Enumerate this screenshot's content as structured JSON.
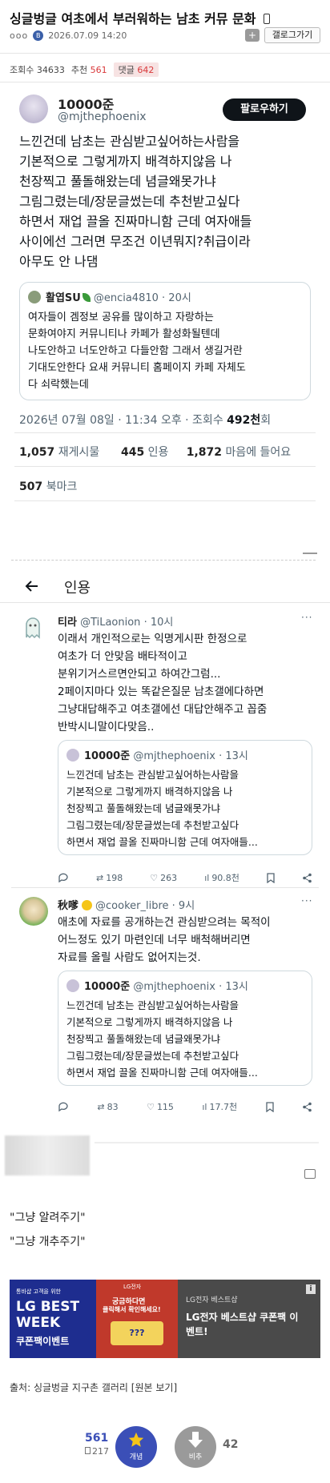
{
  "header": {
    "title": "싱글벙글 여초에서 부러워하는 남초 커뮤 문화",
    "title_icon": "phone-icon",
    "meta_dots": "ooo",
    "datetime": "2026.07.09 14:20",
    "back_label": "갤로그가기",
    "plus_label": "+"
  },
  "stats": {
    "views_label": "조회수",
    "views": "34633",
    "recommend_label": "추천",
    "recommend": "561",
    "comments_label": "댓글",
    "comments": "642"
  },
  "main_tweet": {
    "name": "10000준",
    "handle": "@mjthephoenix",
    "follow_label": "팔로우하기",
    "text_lines": [
      "느낀건데 남초는 관심받고싶어하는사람을",
      "기본적으로 그렇게까지 배격하지않음 나",
      "천장찍고 풀돌해왔는데 념글왜못가냐",
      "그림그렸는데/장문글썼는데 추천받고싶다",
      "하면서 재업 끌올 진짜마니함 근데 여자애들",
      "사이에선 그러면 무조건 이년뭐지?취급이라",
      "아무도 안 나댐"
    ],
    "quote": {
      "name": "활엽SU",
      "handle": "@encia4810",
      "time": "· 20시",
      "text_lines": [
        "여자들이 겜정보 공유를 많이하고 자랑하는",
        "문화여야지 커뮤니티나 카페가 활성화될텐데",
        "나도안하고 너도안하고 다들안함 그래서 생길거란",
        "기대도안한다 요새 커뮤니티 홈페이지 카페 자체도",
        "다 쇠락했는데"
      ]
    },
    "timestamp": "2026년 07월 08일 · 11:34 오후 · 조회수",
    "views": "492천",
    "views_suffix": "회",
    "retweets": "1,057",
    "retweets_label": "재게시물",
    "quotes": "445",
    "quotes_label": "인용",
    "likes": "1,872",
    "likes_label": "마음에 들어요",
    "bookmarks": "507",
    "bookmarks_label": "북마크"
  },
  "quotes_header": {
    "back_icon": "arrow-left-icon",
    "title": "인용"
  },
  "reply1": {
    "name": "티라",
    "handle": "@TiLaonion",
    "time": "· 10시",
    "text_lines": [
      "이래서 개인적으로는 익명게시판 한정으로",
      "여초가 더 안맞음 배타적이고",
      "분위기거스르면안되고 하여간그럼...",
      "2페이지마다 있는 똑같은질문 남초갤에다하면",
      "그냥대답해주고 여초갤에선 대답안해주고 꼽줌",
      "반박시니말이다맞음.."
    ],
    "quote": {
      "name": "10000준",
      "handle": "@mjthephoenix",
      "time": "· 13시",
      "text_lines": [
        "느낀건데 남초는 관심받고싶어하는사람을",
        "기본적으로 그렇게까지 배격하지않음 나",
        "천장찍고 풀돌해왔는데 념글왜못가냐",
        "그림그렸는데/장문글썼는데 추천받고싶다",
        "하면서 재업 끌올 진짜마니함 근데 여자애들..."
      ]
    },
    "retweets": "198",
    "likes": "263",
    "views": "90.8천"
  },
  "reply2": {
    "name": "秋嗲",
    "handle": "@cooker_libre",
    "time": "· 9시",
    "text_lines": [
      "애초에 자료를 공개하는건 관심받으려는 목적이",
      "어느정도 있기 마련인데 너무 배척해버리면",
      "자료를 올릴 사람도 없어지는것."
    ],
    "quote": {
      "name": "10000준",
      "handle": "@mjthephoenix",
      "time": "· 13시",
      "text_lines": [
        "느낀건데 남초는 관심받고싶어하는사람을",
        "기본적으로 그렇게까지 배격하지않음 나",
        "천장찍고 풀돌해왔는데 념글왜못가냐",
        "그림그렸는데/장문글썼는데 추천받고싶다",
        "하면서 재업 끌올 진짜마니함 근데 여자애들..."
      ]
    },
    "retweets": "83",
    "likes": "115",
    "views": "17.7천"
  },
  "post_text": {
    "line1": "\"그냥 알려주기\"",
    "line2": "\"그냥 개추주기\""
  },
  "ad": {
    "small": "통바샵 고객을 위한",
    "brand": "LG BEST",
    "week": "WEEK",
    "coupon": "쿠폰팩이벤트",
    "mid1": "궁금하다면",
    "mid2": "클릭해서 확인해세요!",
    "logo": "LG전자",
    "right_small": "LG전자 베스트샵",
    "right_title_1": "LG전자 베스트샵 쿠폰팩 이",
    "right_title_2": "벤트!",
    "info_icon": "i"
  },
  "source": {
    "label": "출처: 싱글벙글 지구촌 갤러리 [원본 보기]"
  },
  "vote": {
    "up_count": "561",
    "up_sub": "217",
    "up_label": "개념",
    "down_label": "비추",
    "down_count": "42"
  },
  "colors": {
    "accent_red": "#d9383a",
    "vote_blue": "#3b4fb7",
    "star_yellow": "#f5c518"
  }
}
